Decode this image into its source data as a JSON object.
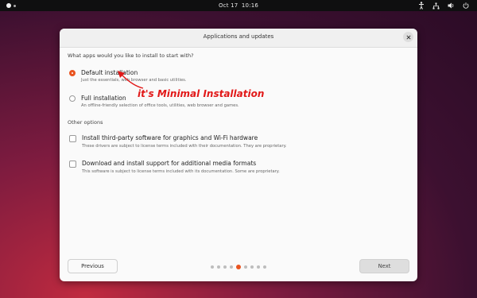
{
  "topbar": {
    "date": "Oct 17",
    "time": "10:16"
  },
  "dialog": {
    "title": "Applications and updates"
  },
  "question": "What apps would you like to install to start with?",
  "install_options": [
    {
      "label": "Default installation",
      "description": "Just the essentials, web browser and basic utilities.",
      "selected": true
    },
    {
      "label": "Full installation",
      "description": "An offline-friendly selection of office tools, utilities, web browser and games.",
      "selected": false
    }
  ],
  "other_options": {
    "heading": "Other options",
    "items": [
      {
        "label": "Install third-party software for graphics and Wi-Fi hardware",
        "description": "These drivers are subject to license terms included with their documentation. They are proprietary.",
        "checked": false
      },
      {
        "label": "Download and install support for additional media formats",
        "description": "This software is subject to license terms included with its documentation. Some are proprietary.",
        "checked": false
      }
    ]
  },
  "footer": {
    "previous_label": "Previous",
    "next_label": "Next",
    "page_count": 9,
    "current_page": 5
  },
  "annotation": {
    "text": "it's Minimal Installation",
    "color": "#e11818"
  },
  "colors": {
    "accent": "#e95420"
  }
}
